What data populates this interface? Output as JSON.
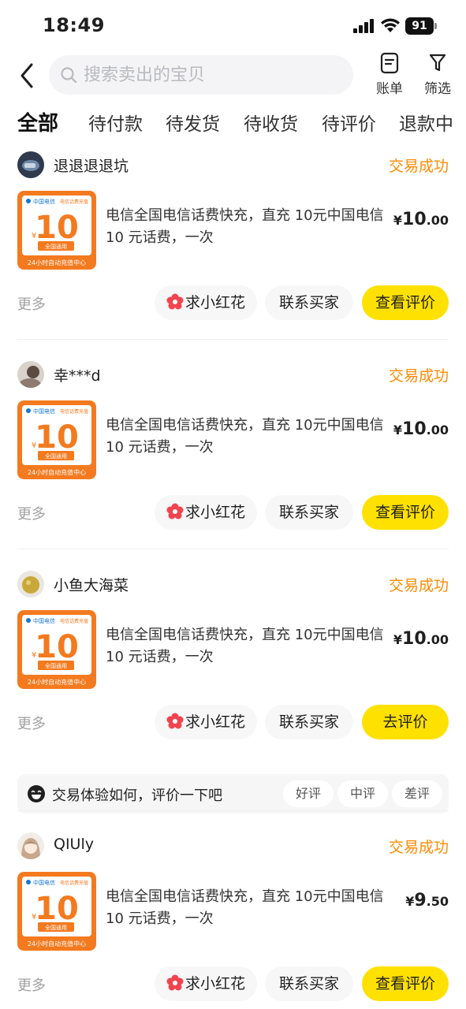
{
  "status_bar": {
    "time": "18:49",
    "battery": "91"
  },
  "search": {
    "placeholder": "搜索卖出的宝贝"
  },
  "header_actions": {
    "bill": "账单",
    "filter": "筛选"
  },
  "tabs": [
    "全部",
    "待付款",
    "待发货",
    "待收货",
    "待评价",
    "退款中"
  ],
  "product_badge": {
    "brand": "中国电信",
    "corner": "电信话费充值",
    "amount": "10",
    "currency": "¥",
    "tag": "全国通用",
    "footer": "24小时自动充值中心"
  },
  "orders": [
    {
      "seller": "退退退退坑",
      "status": "交易成功",
      "title": "电信全国电信话费快充，直充 10元中国电信10 元话费，一次",
      "price": {
        "currency": "¥",
        "integer": "10",
        "decimal": ".00"
      },
      "more": "更多",
      "flower_button": "求小红花",
      "contact_button": "联系买家",
      "primary_button": "查看评价"
    },
    {
      "seller": "幸***d",
      "status": "交易成功",
      "title": "电信全国电信话费快充，直充 10元中国电信10 元话费，一次",
      "price": {
        "currency": "¥",
        "integer": "10",
        "decimal": ".00"
      },
      "more": "更多",
      "flower_button": "求小红花",
      "contact_button": "联系买家",
      "primary_button": "查看评价"
    },
    {
      "seller": "小鱼大海菜",
      "status": "交易成功",
      "title": "电信全国电信话费快充，直充 10元中国电信10 元话费，一次",
      "price": {
        "currency": "¥",
        "integer": "10",
        "decimal": ".00"
      },
      "more": "更多",
      "flower_button": "求小红花",
      "contact_button": "联系买家",
      "primary_button": "去评价",
      "review_prompt": {
        "text": "交易体验如何，评价一下吧",
        "options": [
          "好评",
          "中评",
          "差评"
        ]
      }
    },
    {
      "seller": "QIUly",
      "status": "交易成功",
      "title": "电信全国电信话费快充，直充 10元中国电信10 元话费，一次",
      "price": {
        "currency": "¥",
        "integer": "9",
        "decimal": ".50"
      },
      "more": "更多",
      "flower_button": "求小红花",
      "contact_button": "联系买家",
      "primary_button": "查看评价"
    }
  ],
  "colors": {
    "accent_yellow": "#ffe100",
    "status_orange": "#ff8a00",
    "badge_orange": "#f47a1f",
    "flower_red": "#f0454f"
  },
  "icons": {
    "back": "chevron-left-icon",
    "search": "search-icon",
    "bill": "receipt-icon",
    "filter": "funnel-icon",
    "flower": "flower-icon",
    "review": "grin-face-icon"
  }
}
